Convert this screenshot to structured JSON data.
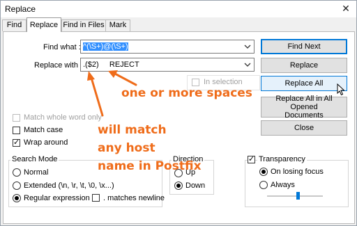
{
  "window": {
    "title": "Replace",
    "close_glyph": "✕"
  },
  "tabs": [
    "Find",
    "Replace",
    "Find in Files",
    "Mark"
  ],
  "find": {
    "label": "Find what :",
    "value": "^(\\S+)@(\\S+)"
  },
  "replace": {
    "label": "Replace with :",
    "value": ".($2)     REJECT"
  },
  "in_selection": "In selection",
  "buttons": {
    "find_next": "Find Next",
    "replace": "Replace",
    "replace_all": "Replace All",
    "replace_all_opened_1": "Replace All in All Opened",
    "replace_all_opened_2": "Documents",
    "close": "Close"
  },
  "options": {
    "match_whole_word": "Match whole word only",
    "match_case": "Match case",
    "wrap_around": "Wrap around"
  },
  "search_mode": {
    "title": "Search Mode",
    "normal": "Normal",
    "extended": "Extended (\\n, \\r, \\t, \\0, \\x...)",
    "regex": "Regular expression",
    "matches_newline": ". matches newline"
  },
  "direction": {
    "title": "Direction",
    "up": "Up",
    "down": "Down"
  },
  "transparency": {
    "title": "Transparency",
    "on_losing_focus": "On losing focus",
    "always": "Always"
  },
  "annotations": {
    "spaces": "one or more spaces",
    "host_1": "will match",
    "host_2": "any host",
    "host_3": "name in Postfix"
  },
  "colors": {
    "annotation": "#ef6c1a",
    "selection": "#3390ff",
    "accent": "#0078d7"
  },
  "icons": {
    "close": "close-icon",
    "chevron": "chevron-down-icon",
    "cursor": "mouse-cursor-icon"
  }
}
